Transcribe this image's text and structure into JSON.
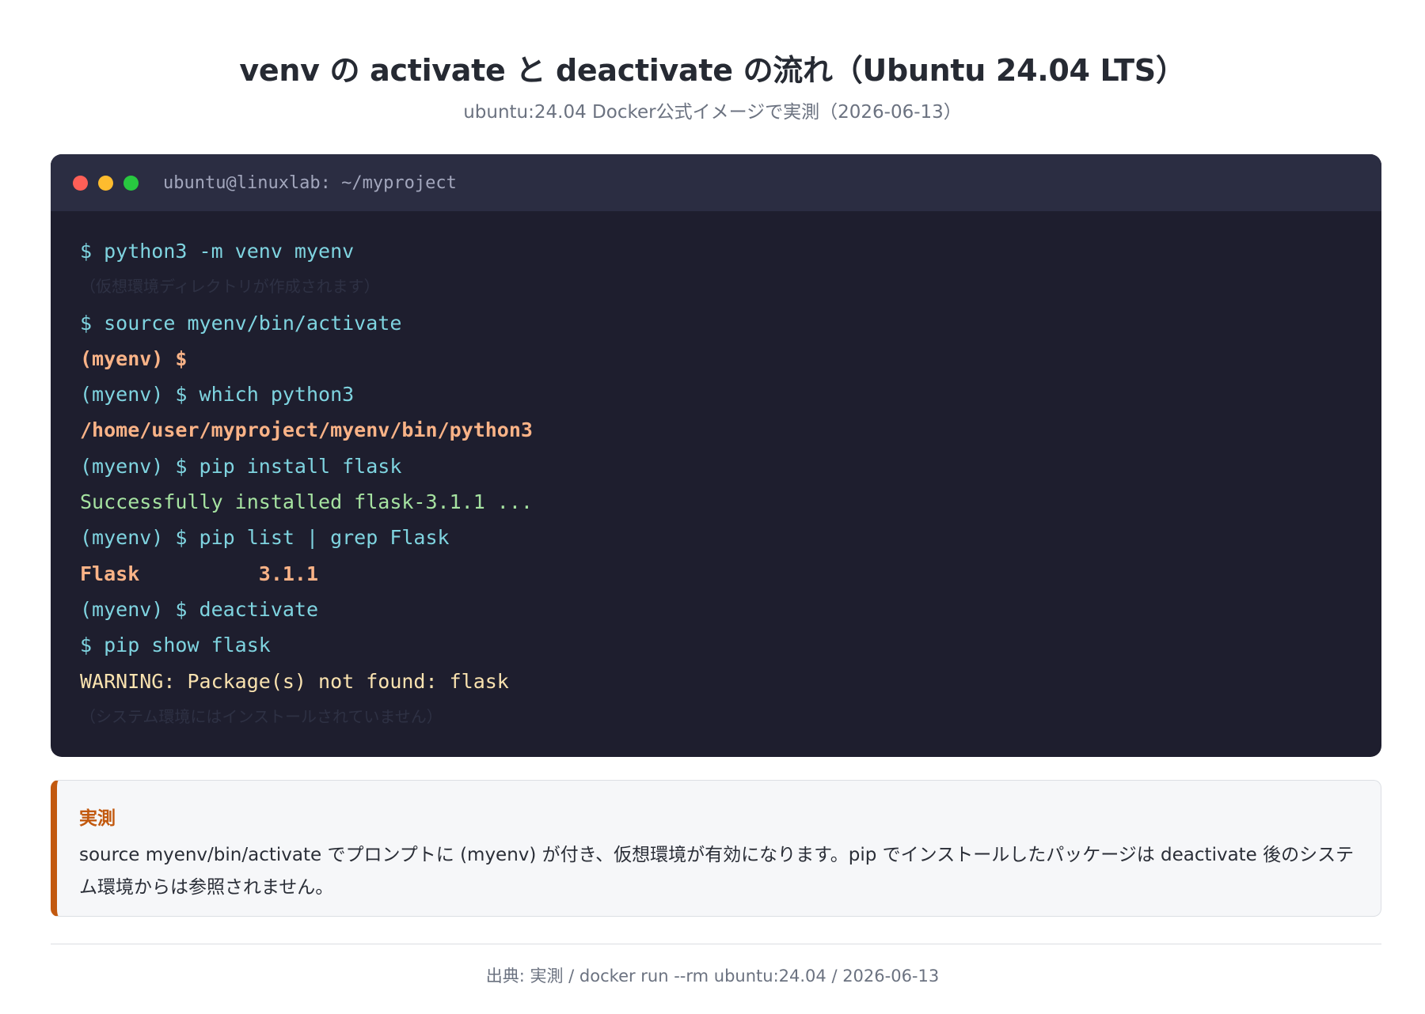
{
  "header": {
    "title": "venv の activate と deactivate の流れ（Ubuntu 24.04 LTS）",
    "subtitle": "ubuntu:24.04 Docker公式イメージで実測（2026-06-13）"
  },
  "terminal": {
    "title": "ubuntu@linuxlab: ~/myproject",
    "colors": {
      "background": "#1e1e2e",
      "titlebar": "#2b2d42",
      "command": "#7fd4e0",
      "highlight": "#fab387",
      "success": "#a6e3a1",
      "warning": "#f9e2af"
    },
    "lines": [
      "$ python3 -m venv myenv",
      "（仮想環境ディレクトリが作成されます）",
      "$ source myenv/bin/activate",
      "(myenv) $",
      "(myenv) $ which python3",
      "/home/user/myproject/myenv/bin/python3",
      "(myenv) $ pip install flask",
      "Successfully installed flask-3.1.1 ...",
      "(myenv) $ pip list | grep Flask",
      "Flask          3.1.1",
      "(myenv) $ deactivate",
      "$ pip show flask",
      "WARNING: Package(s) not found: flask",
      "（システム環境にはインストールされていません）"
    ]
  },
  "note": {
    "heading": "実測",
    "text": "source myenv/bin/activate でプロンプトに (myenv) が付き、仮想環境が有効になります。pip でインストールしたパッケージは deactivate 後のシステム環境からは参照されません。",
    "accent_color": "#c2590f"
  },
  "footer": {
    "source": "出典: 実測 / docker run --rm ubuntu:24.04 / 2026-06-13"
  }
}
